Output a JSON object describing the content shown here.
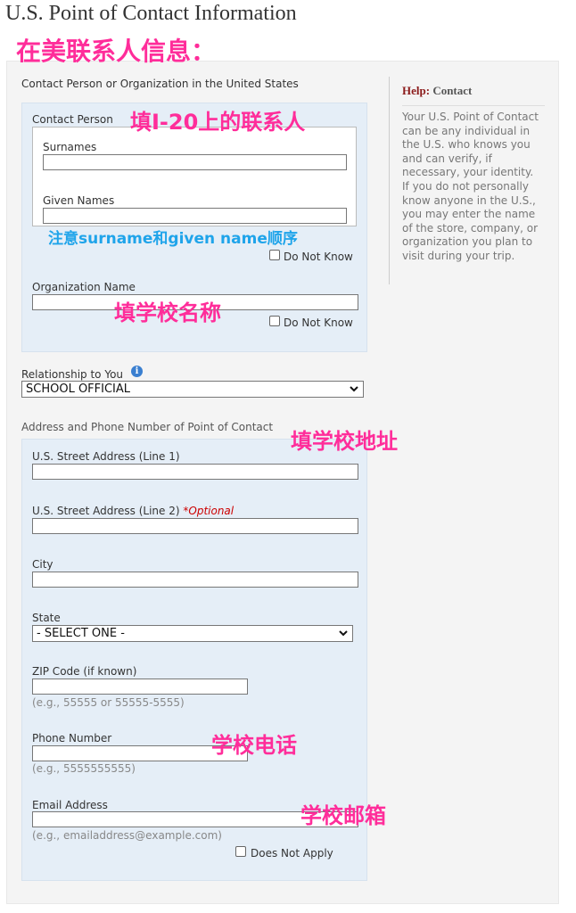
{
  "page_title": "U.S. Point of Contact Information",
  "annotations": {
    "header": "在美联系人信息：",
    "contact_person": "填I-20上的联系人",
    "name_order": "注意surname和given name顺序",
    "organization": "填学校名称",
    "address": "填学校地址",
    "phone": "学校电话",
    "email": "学校邮箱"
  },
  "section1": {
    "title": "Contact Person or Organization in the United States",
    "contact_person_label": "Contact Person",
    "surnames_label": "Surnames",
    "surnames_value": "",
    "given_names_label": "Given Names",
    "given_names_value": "",
    "do_not_know_1": "Do Not Know",
    "organization_label": "Organization Name",
    "organization_value": "",
    "do_not_know_2": "Do Not Know"
  },
  "relationship": {
    "label": "Relationship to You",
    "info_icon": "i",
    "selected": "SCHOOL OFFICIAL"
  },
  "section2": {
    "title": "Address and Phone Number of Point of Contact",
    "street1_label": "U.S. Street Address (Line 1)",
    "street2_label": "U.S. Street Address (Line 2)",
    "street2_optional": "*Optional",
    "city_label": "City",
    "state_label": "State",
    "state_selected": "- SELECT ONE -",
    "zip_label": "ZIP Code (if known)",
    "zip_hint": "(e.g., 55555 or 55555-5555)",
    "phone_label": "Phone Number",
    "phone_hint": "(e.g., 5555555555)",
    "email_label": "Email Address",
    "email_hint": "(e.g., emailaddress@example.com)",
    "does_not_apply": "Does Not Apply"
  },
  "help": {
    "title_prefix": "Help:",
    "title_topic": "Contact",
    "text": "Your U.S. Point of Contact can be any individual in the U.S. who knows you and can verify, if necessary, your identity. If you do not personally know anyone in the U.S., you may enter the name of the store, company, or organization you plan to visit during your trip."
  },
  "colors": {
    "annotation_pink": "#ff2d9a",
    "annotation_blue": "#1fa4ea",
    "help_title": "#8b1a1a",
    "section_blue": "#e5eef7"
  }
}
